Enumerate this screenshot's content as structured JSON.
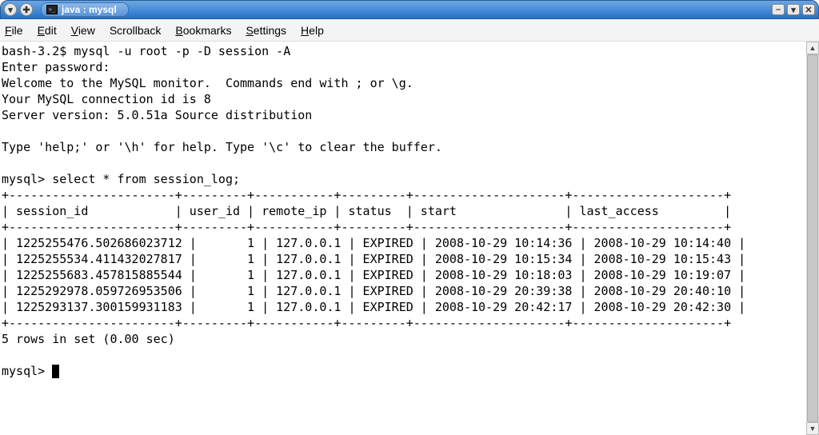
{
  "titlebar": {
    "title": "java : mysql"
  },
  "menu": {
    "file": "File",
    "edit": "Edit",
    "view": "View",
    "scrollback": "Scrollback",
    "bookmarks": "Bookmarks",
    "settings": "Settings",
    "help": "Help"
  },
  "session": {
    "prompt_shell": "bash-3.2$ ",
    "cmd_connect": "mysql -u root -p -D session -A",
    "enter_password": "Enter password:",
    "welcome": "Welcome to the MySQL monitor.  Commands end with ; or \\g.",
    "conn_id": "Your MySQL connection id is 8",
    "server_ver": "Server version: 5.0.51a Source distribution",
    "help_hint": "Type 'help;' or '\\h' for help. Type '\\c' to clear the buffer.",
    "prompt_mysql": "mysql> ",
    "query": "select * from session_log;",
    "summary": "5 rows in set (0.00 sec)"
  },
  "table": {
    "sep": "+-----------------------+---------+-----------+---------+---------------------+---------------------+",
    "header": "| session_id            | user_id | remote_ip | status  | start               | last_access         |",
    "rows": [
      "| 1225255476.502686023712 |       1 | 127.0.0.1 | EXPIRED | 2008-10-29 10:14:36 | 2008-10-29 10:14:40 |",
      "| 1225255534.411432027817 |       1 | 127.0.0.1 | EXPIRED | 2008-10-29 10:15:34 | 2008-10-29 10:15:43 |",
      "| 1225255683.457815885544 |       1 | 127.0.0.1 | EXPIRED | 2008-10-29 10:18:03 | 2008-10-29 10:19:07 |",
      "| 1225292978.059726953506 |       1 | 127.0.0.1 | EXPIRED | 2008-10-29 20:39:38 | 2008-10-29 20:40:10 |",
      "| 1225293137.300159931183 |       1 | 127.0.0.1 | EXPIRED | 2008-10-29 20:42:17 | 2008-10-29 20:42:30 |"
    ]
  }
}
